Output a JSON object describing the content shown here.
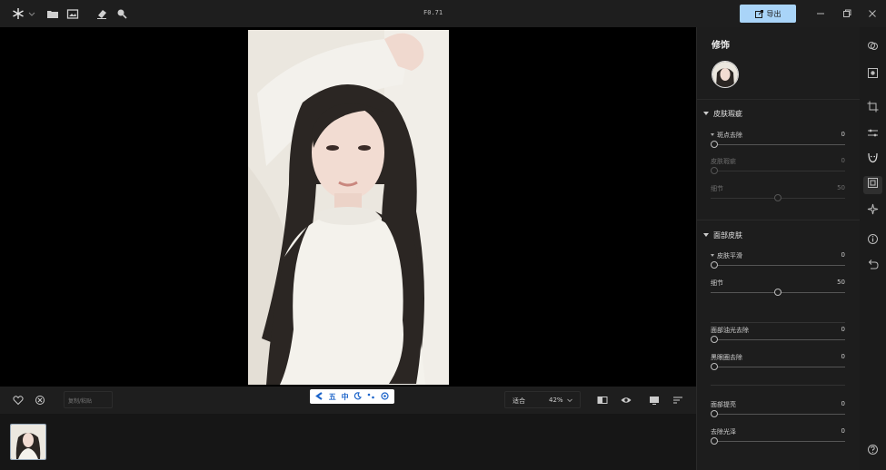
{
  "titlebar": {
    "filename": "F0.71",
    "export_label": "导出",
    "left_icons": [
      "app-logo-icon",
      "folder-icon",
      "image-icon",
      "eraser-icon",
      "magnifier-icon"
    ],
    "window_icons": [
      "minimize-icon",
      "restore-icon",
      "close-icon"
    ]
  },
  "bottombar": {
    "search_placeholder": "复制/粘贴",
    "ime_chars": [
      "五",
      "中"
    ],
    "zoom_fit": "适合",
    "zoom_value": "42%"
  },
  "panel": {
    "title": "修饰",
    "sections": [
      {
        "title": "皮肤瑕疵",
        "rows": [
          {
            "label": "斑点去除",
            "value": "0",
            "dim": false,
            "caret": true
          },
          {
            "label": "皮肤瑕疵",
            "value": "0",
            "dim": true,
            "caret": false
          },
          {
            "label": "细节",
            "value": "50",
            "dim": true,
            "caret": false
          }
        ]
      },
      {
        "title": "面部皮肤",
        "rows": [
          {
            "label": "皮肤平滑",
            "value": "0",
            "dim": false,
            "caret": true
          },
          {
            "label": "细节",
            "value": "50",
            "dim": false,
            "caret": false
          },
          {
            "label": "面部油光去除",
            "value": "0",
            "dim": false,
            "caret": false
          },
          {
            "label": "黑眼圈去除",
            "value": "0",
            "dim": false,
            "caret": false
          },
          {
            "label": "面部提亮",
            "value": "0",
            "dim": false,
            "caret": false
          },
          {
            "label": "去除光泽",
            "value": "0",
            "dim": false,
            "caret": false
          }
        ]
      }
    ]
  },
  "colors": {
    "accent": "#a9d4f8",
    "background": "#1b1b1b",
    "ime_blue": "#1b63c9"
  }
}
